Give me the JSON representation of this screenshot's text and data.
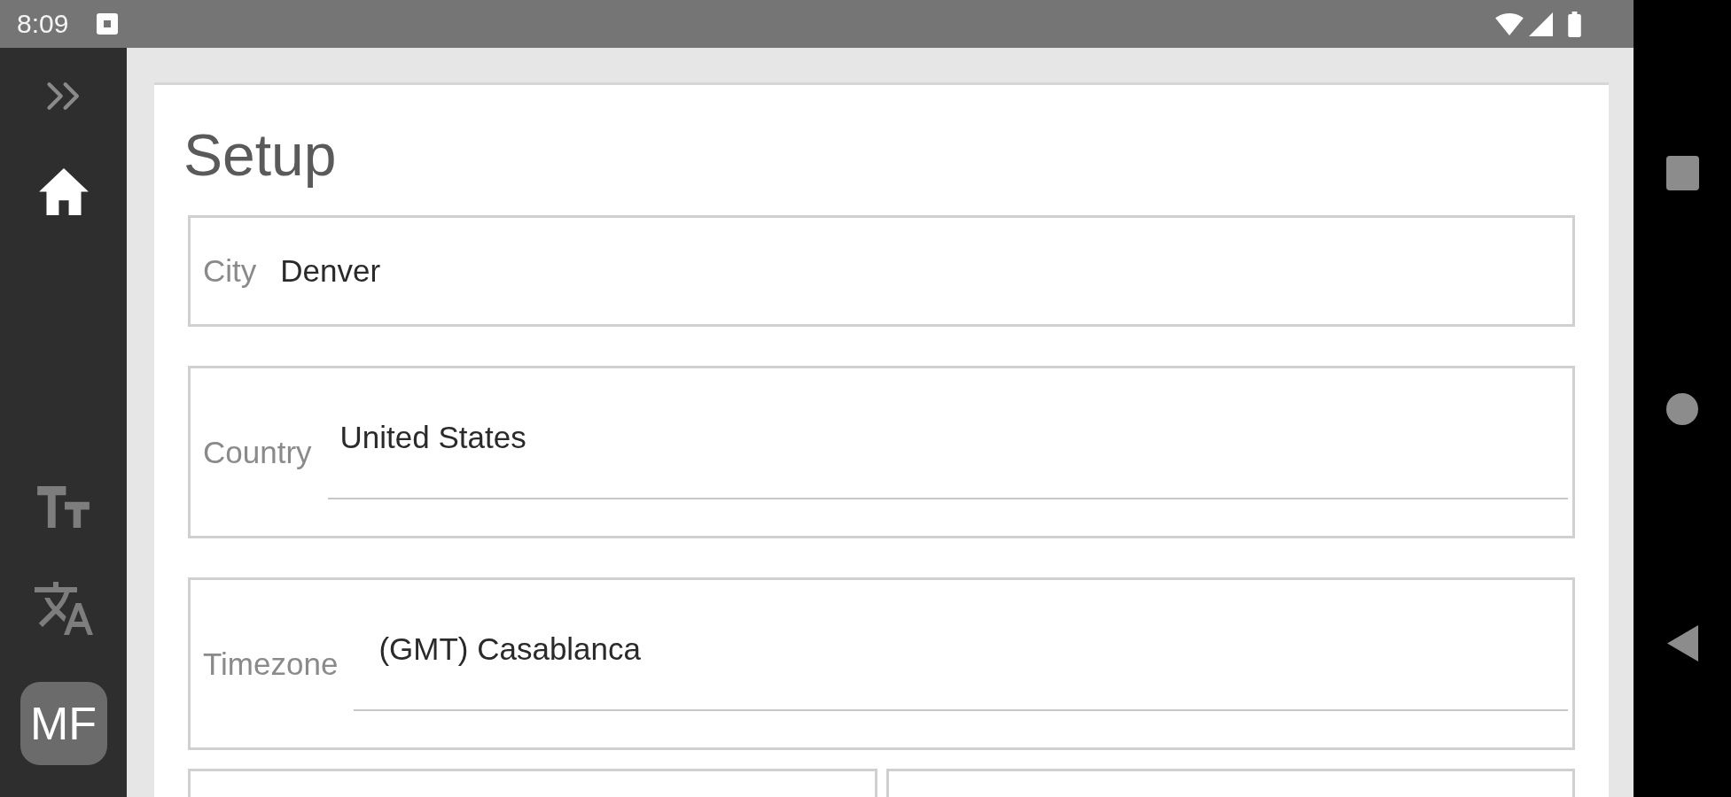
{
  "status_bar": {
    "time": "8:09"
  },
  "sidebar": {
    "nav_items": [
      {
        "kind": "home",
        "selected": true
      }
    ],
    "tools": [
      {
        "kind": "text-size"
      },
      {
        "kind": "translate"
      }
    ],
    "avatar": {
      "initials": "MF"
    }
  },
  "page": {
    "title": "Setup",
    "fields": [
      {
        "kind": "inline",
        "label": "City",
        "value": "Denver"
      },
      {
        "kind": "text",
        "label": "Country",
        "value": "United States"
      },
      {
        "kind": "dropdown",
        "label": "Timezone",
        "value": "(GMT) Casablanca"
      }
    ]
  }
}
